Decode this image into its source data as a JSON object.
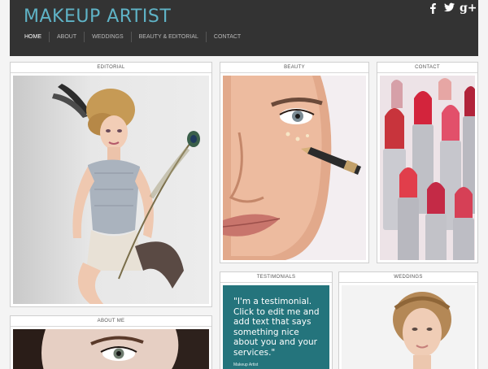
{
  "header": {
    "site_title": "MAKEUP ARTIST",
    "social": [
      "facebook-icon",
      "twitter-icon",
      "google-plus-icon"
    ],
    "google_plus_text": "g+",
    "bg_color": "#333333",
    "title_color": "#5fb3c6"
  },
  "nav": {
    "items": [
      "HOME",
      "ABOUT",
      "WEDDINGS",
      "BEAUTY & EDITORIAL",
      "CONTACT"
    ],
    "active": "HOME"
  },
  "panels": {
    "editorial": {
      "title": "EDITORIAL"
    },
    "beauty": {
      "title": "BEAUTY"
    },
    "contact": {
      "title": "CONTACT"
    },
    "testimonials": {
      "title": "TESTIMONIALS",
      "quote": "\"I'm a testimonial. Click to edit me and add text that says something nice about you and your services.\"",
      "author": "Makeup Artist",
      "bg_color": "#24747c"
    },
    "weddings": {
      "title": "WEDDINGS"
    },
    "about": {
      "title": "ABOUT ME"
    }
  }
}
